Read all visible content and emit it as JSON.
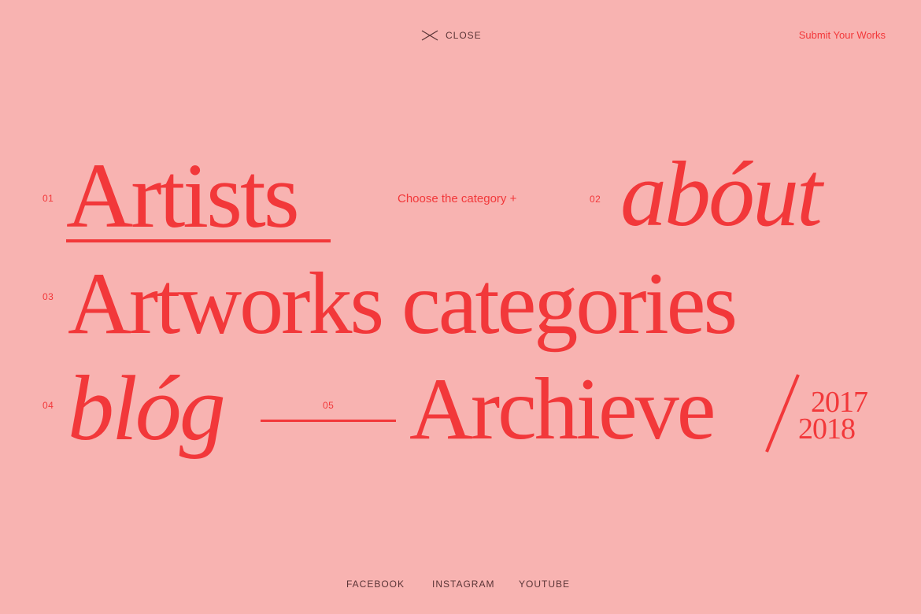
{
  "header": {
    "close_label": "CLOSE",
    "submit_label": "Submit Your Works"
  },
  "menu": {
    "choose_category": "Choose the category +",
    "items": [
      {
        "number": "01",
        "label": "Artists"
      },
      {
        "number": "02",
        "label": "abóut"
      },
      {
        "number": "03",
        "label": "Artworks categories"
      },
      {
        "number": "04",
        "label": "blóg"
      },
      {
        "number": "05",
        "label": "Archieve"
      }
    ],
    "archive_years": [
      "2017",
      "2018"
    ]
  },
  "footer": {
    "social": [
      "FACEBOOK",
      "INSTAGRAM",
      "YOUTUBE"
    ]
  },
  "colors": {
    "background": "#f8b3b1",
    "accent": "#f2383a",
    "muted_text": "#5a3436"
  },
  "icons": {
    "close": "close-icon"
  }
}
